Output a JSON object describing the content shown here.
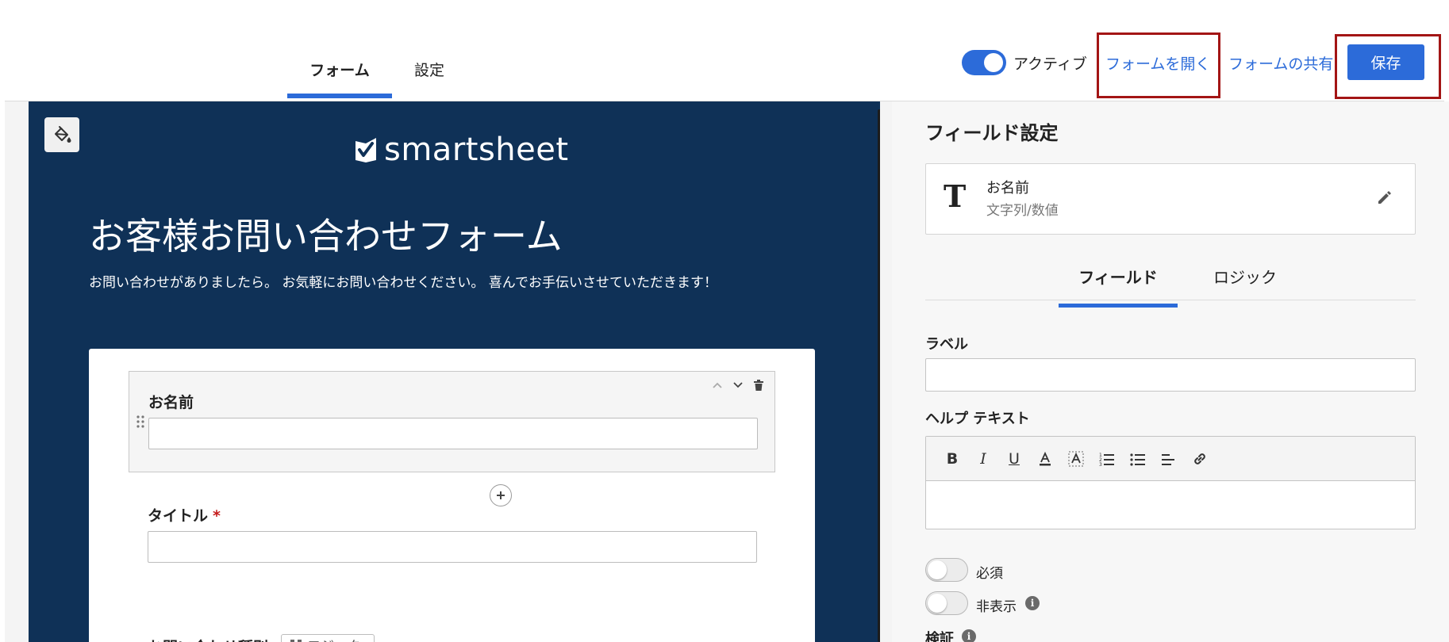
{
  "header": {
    "tabs": [
      {
        "label": "フォーム",
        "active": true
      },
      {
        "label": "設定",
        "active": false
      }
    ],
    "active_toggle_label": "アクティブ",
    "open_form": "フォームを開く",
    "share_form": "フォームの共有",
    "save": "保存"
  },
  "form": {
    "logo_text": "smartsheet",
    "title": "お客様お問い合わせフォーム",
    "description": "お問い合わせがありましたら。 お気軽にお問い合わせください。 喜んでお手伝いさせていただきます！",
    "fields": [
      {
        "label": "お名前",
        "required": false
      },
      {
        "label": "タイトル",
        "required": true
      },
      {
        "label": "お問い合わせ種別",
        "required": false
      }
    ],
    "required_mark": "*",
    "logic_chip": "ロジック"
  },
  "panel": {
    "title": "フィールド設定",
    "field_type": {
      "name": "お名前",
      "type_label": "文字列/数値",
      "icon": "T"
    },
    "tabs": [
      {
        "label": "フィールド",
        "active": true
      },
      {
        "label": "ロジック",
        "active": false
      }
    ],
    "label_heading": "ラベル",
    "label_value": "",
    "help_heading": "ヘルプ テキスト",
    "toolbar": [
      "bold-icon",
      "italic-icon",
      "underline-icon",
      "text-color-icon",
      "highlight-icon",
      "numbered-list-icon",
      "bullet-list-icon",
      "align-icon",
      "link-icon"
    ],
    "required_label": "必須",
    "required_on": false,
    "hidden_label": "非表示",
    "hidden_on": false,
    "validation_label": "検証"
  },
  "colors": {
    "accent": "#2c6bd9",
    "canvas_bg": "#0f3157",
    "highlight": "#a31515"
  }
}
